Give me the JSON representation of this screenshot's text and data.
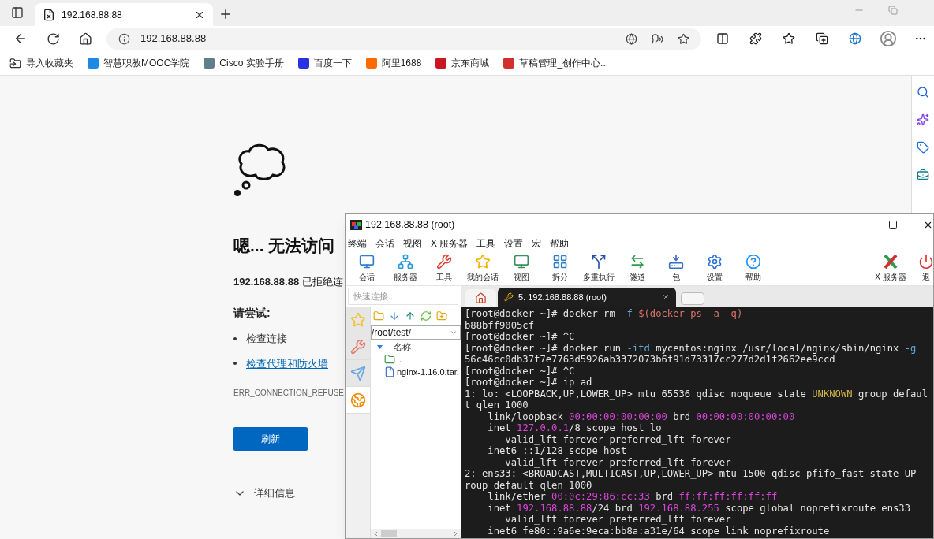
{
  "browser": {
    "tab": {
      "title": "192.168.88.88",
      "selected": true
    },
    "address": "192.168.88.88",
    "bookmarks": [
      {
        "label": "导入收藏夹",
        "kind": "import"
      },
      {
        "label": "智慧职教MOOC学院",
        "kind": "site",
        "color": "#1e88e5"
      },
      {
        "label": "Cisco 实验手册",
        "kind": "site",
        "color": "#607d8b"
      },
      {
        "label": "百度一下",
        "kind": "site",
        "color": "#2932e1"
      },
      {
        "label": "阿里1688",
        "kind": "site",
        "color": "#ff6a00"
      },
      {
        "label": "京东商城",
        "kind": "site",
        "color": "#c91623"
      },
      {
        "label": "草稿管理_创作中心...",
        "kind": "site",
        "color": "#d32f2f"
      }
    ]
  },
  "error_page": {
    "heading": "嗯... 无法访问",
    "message": "**192.168.88.88** 已拒绝连",
    "try_heading": "请尝试:",
    "suggestions": [
      {
        "text": "检查连接",
        "kind": "text"
      },
      {
        "text": "检查代理和防火墙",
        "kind": "link"
      }
    ],
    "error_code": "ERR_CONNECTION_REFUSE",
    "button": "刷新",
    "details": "详细信息"
  },
  "xshell": {
    "title": "192.168.88.88 (root)",
    "menu": [
      "终端",
      "会话",
      "视图",
      "X 服务器",
      "工具",
      "设置",
      "宏",
      "帮助"
    ],
    "toolbar": [
      "会话",
      "服务器",
      "工具",
      "我的会话",
      "视图",
      "拆分",
      "多重执行",
      "隧道",
      "包",
      "设置",
      "帮助"
    ],
    "toolbar_right": [
      "X 服务器",
      "退"
    ],
    "quick_connect": {
      "placeholder": "快速连接..."
    },
    "side_tabs": [
      {
        "selected": false
      },
      {
        "selected": false
      },
      {
        "selected": false
      },
      {
        "selected": true
      }
    ],
    "file_panel": {
      "path": "/root/test/",
      "column": "名称",
      "entries": [
        {
          "name": "..",
          "kind": "folder"
        },
        {
          "name": "nginx-1.16.0.tar.",
          "kind": "file"
        }
      ]
    },
    "tabs": [
      {
        "kind": "home",
        "selected": false
      },
      {
        "kind": "session",
        "label": "5. 192.168.88.88 (root)",
        "selected": true
      }
    ],
    "terminal": [
      [
        {
          "text": "[root@docker ~]# docker rm ",
          "kind": "plain"
        },
        {
          "text": "-f",
          "kind": "option"
        },
        {
          "text": " $(docker ps -a -q)",
          "kind": "subshell"
        }
      ],
      [
        {
          "text": "b88bff9005cf",
          "kind": "plain"
        }
      ],
      [
        {
          "text": "[root@docker ~]# ^C",
          "kind": "plain"
        }
      ],
      [
        {
          "text": "[root@docker ~]# docker run ",
          "kind": "plain"
        },
        {
          "text": "-itd",
          "kind": "option"
        },
        {
          "text": " mycentos:nginx /usr/local/nginx/sbin/nginx ",
          "kind": "plain"
        },
        {
          "text": "-g",
          "kind": "option"
        }
      ],
      [
        {
          "text": "56c46cc0db37f7e7763d5926ab3372073b6f91d73317cc277d2d1f2662ee9ccd",
          "kind": "plain"
        }
      ],
      [
        {
          "text": "[root@docker ~]# ^C",
          "kind": "plain"
        }
      ],
      [
        {
          "text": "[root@docker ~]# ip ad",
          "kind": "plain"
        }
      ],
      [
        {
          "text": "1: lo: <LOOPBACK,UP,LOWER_UP> mtu 65536 qdisc noqueue state ",
          "kind": "plain"
        },
        {
          "text": "UNKNOWN",
          "kind": "warning"
        },
        {
          "text": " group defaul",
          "kind": "plain"
        }
      ],
      [
        {
          "text": "t qlen 1000",
          "kind": "plain"
        }
      ],
      [
        {
          "text": "    link/loopback ",
          "kind": "plain"
        },
        {
          "text": "00:00:00:00:00:00",
          "kind": "address"
        },
        {
          "text": " brd ",
          "kind": "plain"
        },
        {
          "text": "00:00:00:00:00:00",
          "kind": "address"
        }
      ],
      [
        {
          "text": "    inet ",
          "kind": "plain"
        },
        {
          "text": "127.0.0.1",
          "kind": "address"
        },
        {
          "text": "/8 scope host lo",
          "kind": "plain"
        }
      ],
      [
        {
          "text": "       valid_lft forever preferred_lft forever",
          "kind": "plain"
        }
      ],
      [
        {
          "text": "    inet6 ::1/128 scope host",
          "kind": "plain"
        }
      ],
      [
        {
          "text": "       valid_lft forever preferred_lft forever",
          "kind": "plain"
        }
      ],
      [
        {
          "text": "2: ens33: <BROADCAST,MULTICAST,UP,LOWER_UP> mtu 1500 qdisc pfifo_fast state UP",
          "kind": "plain"
        }
      ],
      [
        {
          "text": "roup default qlen 1000",
          "kind": "plain"
        }
      ],
      [
        {
          "text": "    link/ether ",
          "kind": "plain"
        },
        {
          "text": "00:0c:29:86:cc:33",
          "kind": "address"
        },
        {
          "text": " brd ",
          "kind": "plain"
        },
        {
          "text": "ff:ff:ff:ff:ff:ff",
          "kind": "address"
        }
      ],
      [
        {
          "text": "    inet ",
          "kind": "plain"
        },
        {
          "text": "192.168.88.88",
          "kind": "address"
        },
        {
          "text": "/24 brd ",
          "kind": "plain"
        },
        {
          "text": "192.168.88.255",
          "kind": "address"
        },
        {
          "text": " scope global noprefixroute ens33",
          "kind": "plain"
        }
      ],
      [
        {
          "text": "       valid_lft forever preferred_lft forever",
          "kind": "plain"
        }
      ],
      [
        {
          "text": "    inet6 fe80::9a6e:9eca:bb8a:a31e/64 scope link noprefixroute",
          "kind": "plain"
        }
      ]
    ]
  }
}
